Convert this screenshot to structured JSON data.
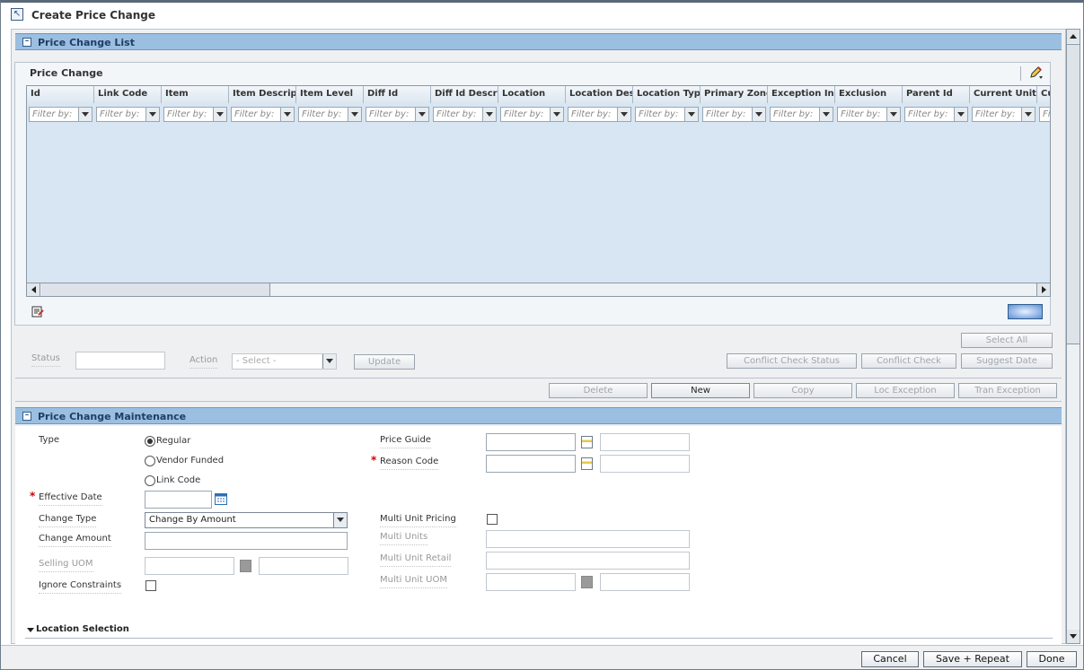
{
  "window": {
    "title": "Create Price Change"
  },
  "list_section": {
    "title": "Price Change List"
  },
  "table": {
    "title": "Price Change",
    "filter_placeholder": "Filter by:",
    "columns": [
      "Id",
      "Link Code",
      "Item",
      "Item Descripti",
      "Item Level",
      "Diff Id",
      "Diff Id Descrip",
      "Location",
      "Location Desc",
      "Location Type",
      "Primary Zone",
      "Exception Ind",
      "Exclusion",
      "Parent Id",
      "Current Unit R",
      "Cu"
    ]
  },
  "list_controls": {
    "status_label": "Status",
    "status_value": "",
    "action_label": "Action",
    "action_value": "- Select -",
    "update_label": "Update",
    "select_all_label": "Select All",
    "conflict_check_status_label": "Conflict Check Status",
    "conflict_check_label": "Conflict Check",
    "suggest_date_label": "Suggest Date"
  },
  "action_bar": {
    "delete_label": "Delete",
    "new_label": "New",
    "copy_label": "Copy",
    "loc_exception_label": "Loc Exception",
    "tran_exception_label": "Tran Exception"
  },
  "maintenance": {
    "title": "Price Change Maintenance",
    "type_label": "Type",
    "type_options": [
      "Regular",
      "Vendor Funded",
      "Link Code"
    ],
    "type_selected": "Regular",
    "effective_date_label": "Effective Date",
    "effective_date_value": "",
    "change_type_label": "Change Type",
    "change_type_value": "Change By Amount",
    "change_amount_label": "Change Amount",
    "change_amount_value": "",
    "selling_uom_label": "Selling UOM",
    "ignore_constraints_label": "Ignore Constraints",
    "price_guide_label": "Price Guide",
    "reason_code_label": "Reason Code",
    "multi_unit_pricing_label": "Multi Unit Pricing",
    "multi_units_label": "Multi Units",
    "multi_unit_retail_label": "Multi Unit Retail",
    "multi_unit_uom_label": "Multi Unit UOM",
    "location_selection_label": "Location Selection"
  },
  "footer": {
    "cancel_label": "Cancel",
    "save_repeat_label": "Save + Repeat",
    "done_label": "Done"
  },
  "colors": {
    "section_header": "#9bbfe0",
    "grid_background": "#d8e6f3",
    "required": "#cc0000"
  }
}
